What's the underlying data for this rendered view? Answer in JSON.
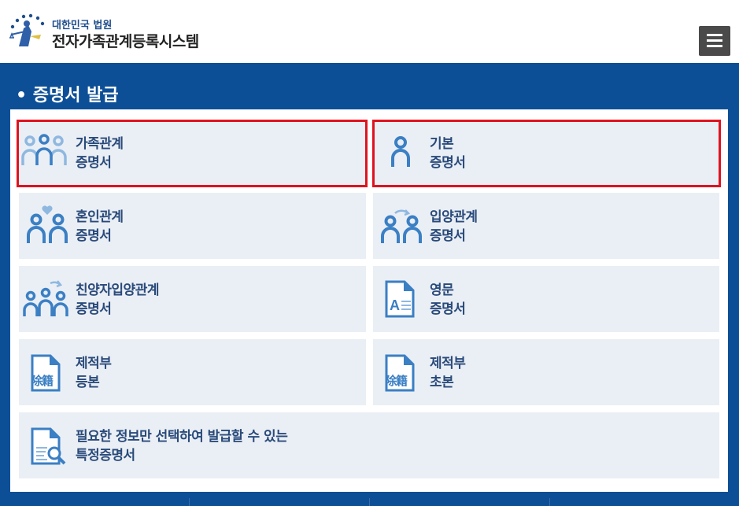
{
  "header": {
    "org_name": "대한민국 법원",
    "system_name": "전자가족관계등록시스템",
    "menu_icon": "hamburger-icon"
  },
  "section": {
    "title": "• 증명서 발급"
  },
  "cards": [
    {
      "line1": "가족관계",
      "line2": "증명서",
      "icon": "family-icon",
      "highlighted": true
    },
    {
      "line1": "기본",
      "line2": "증명서",
      "icon": "person-icon",
      "highlighted": true
    },
    {
      "line1": "혼인관계",
      "line2": "증명서",
      "icon": "couple-heart-icon",
      "highlighted": false
    },
    {
      "line1": "입양관계",
      "line2": "증명서",
      "icon": "adoption-icon",
      "highlighted": false
    },
    {
      "line1": "친양자입양관계",
      "line2": "증명서",
      "icon": "family-adoption-icon",
      "highlighted": false
    },
    {
      "line1": "영문",
      "line2": "증명서",
      "icon": "english-document-icon",
      "highlighted": false
    },
    {
      "line1": "제적부",
      "line2": "등본",
      "icon": "removed-register-document-icon",
      "icon_text": "除籍",
      "highlighted": false
    },
    {
      "line1": "제적부",
      "line2": "초본",
      "icon": "removed-register-document-icon",
      "icon_text": "除籍",
      "highlighted": false
    },
    {
      "line1": "필요한 정보만 선택하여 발급할 수 있는",
      "line2": "특정증명서",
      "icon": "document-search-icon",
      "highlighted": false
    }
  ],
  "colors": {
    "header_bar": "#0d4f96",
    "card_bg": "#eaeff5",
    "highlight": "#e0121f",
    "icon_blue": "#3b7fc4",
    "icon_light": "#8fb8e0",
    "label": "#2a4a7a"
  }
}
